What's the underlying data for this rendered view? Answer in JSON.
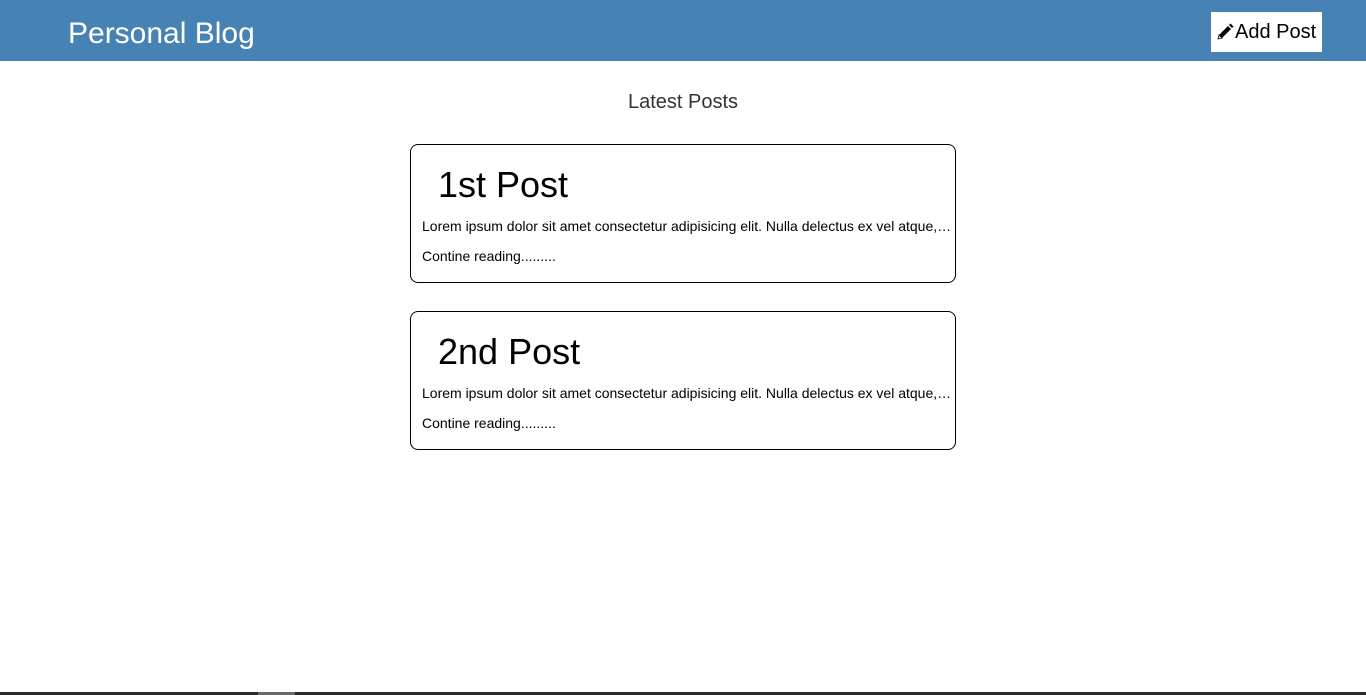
{
  "header": {
    "brand": "Personal Blog",
    "add_post_label": "Add Post",
    "add_post_icon": "pencil-icon",
    "background_color": "#4682b4"
  },
  "main": {
    "section_title": "Latest Posts",
    "posts": [
      {
        "title": "1st Post",
        "excerpt": "Lorem ipsum dolor sit amet consectetur adipisicing elit. Nulla delectus ex vel atque, quibusdam",
        "read_more": "Contine reading........."
      },
      {
        "title": "2nd Post",
        "excerpt": "Lorem ipsum dolor sit amet consectetur adipisicing elit. Nulla delectus ex vel atque, quibusdam",
        "read_more": "Contine reading........."
      }
    ]
  }
}
